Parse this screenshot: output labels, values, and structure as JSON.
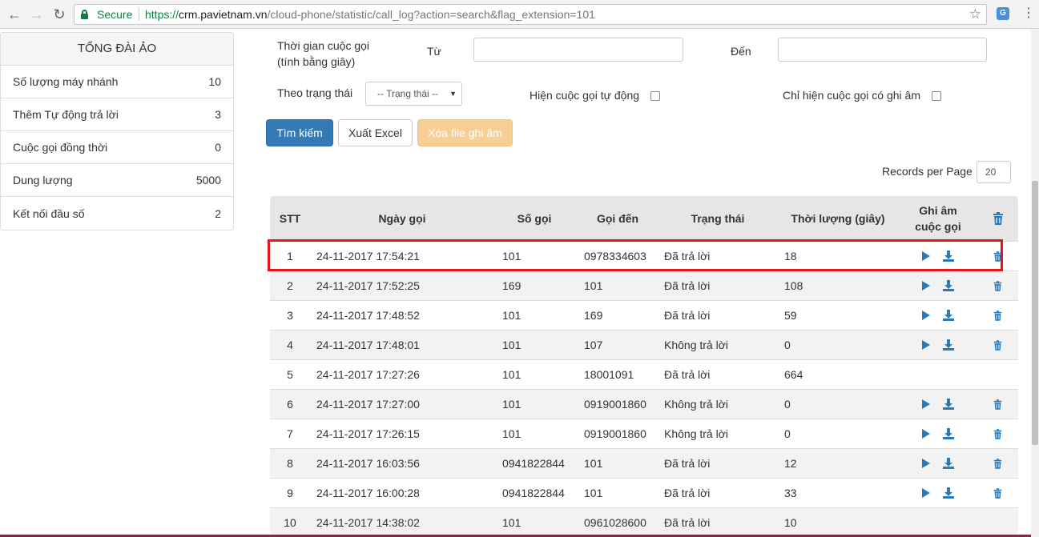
{
  "browser": {
    "secure_label": "Secure",
    "url_scheme": "https://",
    "url_host": "crm.pavietnam.vn",
    "url_path": "/cloud-phone/statistic/call_log?action=search&flag_extension=101"
  },
  "sidebar": {
    "title": "TỔNG ĐÀI ẢO",
    "items": [
      {
        "label": "Số lượng máy nhánh",
        "value": "10"
      },
      {
        "label": "Thêm Tự động trả lời",
        "value": "3"
      },
      {
        "label": "Cuộc gọi đồng thời",
        "value": "0"
      },
      {
        "label": "Dung lượng",
        "value": "5000"
      },
      {
        "label": "Kết nối đầu số",
        "value": "2"
      }
    ]
  },
  "filters": {
    "duration_label_1": "Thời gian cuộc gọi",
    "duration_label_2": "(tính bằng giây)",
    "from_label": "Từ",
    "to_label": "Đến",
    "from_value": "",
    "to_value": "",
    "status_label": "Theo trạng thái",
    "status_value": "-- Trạng thái --",
    "auto_calls_label": "Hiện cuộc gọi tự động",
    "auto_calls_checked": false,
    "recorded_only_label": "Chỉ hiện cuộc gọi có ghi âm",
    "recorded_only_checked": false
  },
  "actions": {
    "search": "Tìm kiếm",
    "export": "Xuất Excel",
    "delete_recordings": "Xóa file ghi âm"
  },
  "pagination": {
    "records_per_page_label": "Records per Page",
    "records_per_page": "20"
  },
  "table": {
    "headers": {
      "stt": "STT",
      "date": "Ngày gọi",
      "caller": "Số gọi",
      "callee": "Gọi đến",
      "status": "Trạng thái",
      "duration": "Thời lượng (giây)",
      "recording_1": "Ghi âm",
      "recording_2": "cuộc gọi"
    },
    "rows": [
      {
        "stt": "1",
        "date": "24-11-2017 17:54:21",
        "caller": "101",
        "callee": "0978334603",
        "status": "Đã trả lời",
        "duration": "18",
        "has_recording": true
      },
      {
        "stt": "2",
        "date": "24-11-2017 17:52:25",
        "caller": "169",
        "callee": "101",
        "status": "Đã trả lời",
        "duration": "108",
        "has_recording": true
      },
      {
        "stt": "3",
        "date": "24-11-2017 17:48:52",
        "caller": "101",
        "callee": "169",
        "status": "Đã trả lời",
        "duration": "59",
        "has_recording": true
      },
      {
        "stt": "4",
        "date": "24-11-2017 17:48:01",
        "caller": "101",
        "callee": "107",
        "status": "Không trả lời",
        "duration": "0",
        "has_recording": true
      },
      {
        "stt": "5",
        "date": "24-11-2017 17:27:26",
        "caller": "101",
        "callee": "18001091",
        "status": "Đã trả lời",
        "duration": "664",
        "has_recording": false
      },
      {
        "stt": "6",
        "date": "24-11-2017 17:27:00",
        "caller": "101",
        "callee": "0919001860",
        "status": "Không trả lời",
        "duration": "0",
        "has_recording": true
      },
      {
        "stt": "7",
        "date": "24-11-2017 17:26:15",
        "caller": "101",
        "callee": "0919001860",
        "status": "Không trả lời",
        "duration": "0",
        "has_recording": true
      },
      {
        "stt": "8",
        "date": "24-11-2017 16:03:56",
        "caller": "0941822844",
        "callee": "101",
        "status": "Đã trả lời",
        "duration": "12",
        "has_recording": true
      },
      {
        "stt": "9",
        "date": "24-11-2017 16:00:28",
        "caller": "0941822844",
        "callee": "101",
        "status": "Đã trả lời",
        "duration": "33",
        "has_recording": true
      },
      {
        "stt": "10",
        "date": "24-11-2017 14:38:02",
        "caller": "101",
        "callee": "0961028600",
        "status": "Đã trả lời",
        "duration": "10",
        "has_recording": false
      }
    ]
  },
  "colors": {
    "primary": "#337ab7",
    "warning": "#f7cf94",
    "highlight": "#e8141b",
    "icon_blue": "#2a7ab8",
    "secure_green": "#0b8043"
  }
}
